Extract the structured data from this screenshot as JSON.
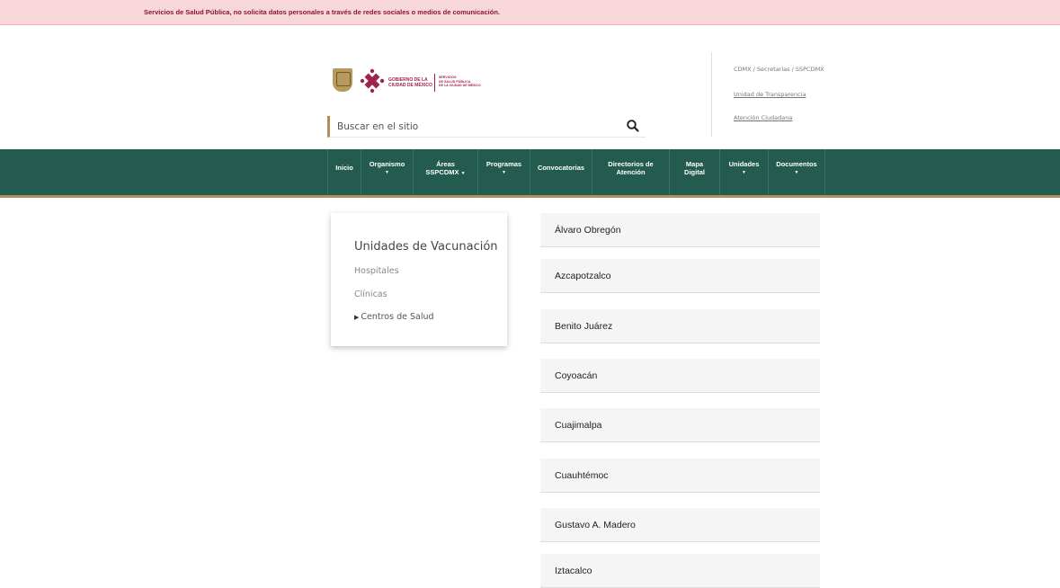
{
  "alert": {
    "text": "Servicios de Salud Pública, no solicita datos personales a través de redes sociales o medios de comunicación."
  },
  "header": {
    "gov_line1": "GOBIERNO DE LA",
    "gov_line2": "CIUDAD DE MÉXICO",
    "ssp_line1": "SERVICIOS",
    "ssp_line2": "DE SALUD PÚBLICA",
    "ssp_line3": "DE LA CIUDAD DE MÉXICO",
    "search": {
      "placeholder": "Buscar en el sitio",
      "icon": "search-icon"
    },
    "breadcrumb": "CDMX / Secretarías / SSPCDMX",
    "link_transparencia": "Unidad de Transparencia",
    "link_atencion": "Atención Ciudadana"
  },
  "nav": {
    "inicio": "Inicio",
    "organismo": "Organismo",
    "areas_1": "Áreas",
    "areas_2": "SSPCDMX",
    "programas": "Programas",
    "convocatorias": "Convocatorias",
    "directorios_1": "Directorios de",
    "directorios_2": "Atención",
    "mapa_1": "Mapa",
    "mapa_2": "Digital",
    "unidades": "Unidades",
    "documentos": "Documentos",
    "caret": "▼"
  },
  "sidebar": {
    "title": "Unidades de Vacunación",
    "items": [
      "Hospitales",
      "Clínicas",
      "Centros de Salud"
    ],
    "active_marker": "▶"
  },
  "units": [
    "Álvaro Obregón",
    "Azcapotzalco",
    "Benito Juárez",
    "Coyoacán",
    "Cuajimalpa",
    "Cuauhtémoc",
    "Gustavo A. Madero",
    "Iztacalco"
  ],
  "colors": {
    "nav_green": "#235b4e",
    "gold": "#b38e5d",
    "brand_red": "#9d2449",
    "alert_bg": "#f8d7da"
  }
}
